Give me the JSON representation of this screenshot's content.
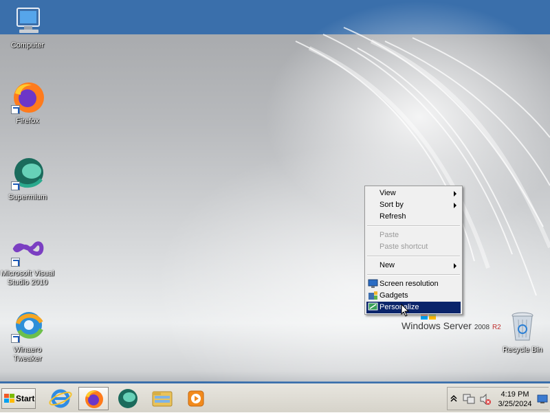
{
  "desktop": {
    "icons": [
      {
        "label": "Computer",
        "icon": "computer-icon"
      },
      {
        "label": "Firefox",
        "icon": "firefox-icon"
      },
      {
        "label": "Supermium",
        "icon": "supermium-icon"
      },
      {
        "label": "Microsoft Visual Studio 2010",
        "icon": "visual-studio-icon"
      },
      {
        "label": "Winaero Tweaker",
        "icon": "winaero-tweaker-icon"
      },
      {
        "label": "Recycle Bin",
        "icon": "recycle-bin-icon"
      }
    ],
    "branding": {
      "name": "Windows Server",
      "version": "2008",
      "edition": "R2"
    }
  },
  "context_menu": {
    "items": [
      {
        "label": "View",
        "submenu": true
      },
      {
        "label": "Sort by",
        "submenu": true
      },
      {
        "label": "Refresh"
      },
      {
        "label": "Paste",
        "disabled": true
      },
      {
        "label": "Paste shortcut",
        "disabled": true
      },
      {
        "label": "New",
        "submenu": true
      },
      {
        "label": "Screen resolution",
        "icon": "display-icon"
      },
      {
        "label": "Gadgets",
        "icon": "gadgets-icon"
      },
      {
        "label": "Personalize",
        "icon": "personalize-icon",
        "highlighted": true
      }
    ]
  },
  "taskbar": {
    "start_label": "Start",
    "pinned": [
      "internet-explorer-icon",
      "firefox-icon",
      "supermium-icon",
      "file-explorer-icon",
      "media-player-icon"
    ],
    "active": "firefox-icon",
    "tray_icons": [
      "show-hidden-icons-chevron",
      "network-icon",
      "volume-muted-icon",
      "action-center-icon"
    ],
    "clock": {
      "time": "4:19 PM",
      "date": "3/25/2024"
    }
  },
  "colors": {
    "accent": "#3a6fab",
    "menu_highlight": "#0a246a"
  }
}
